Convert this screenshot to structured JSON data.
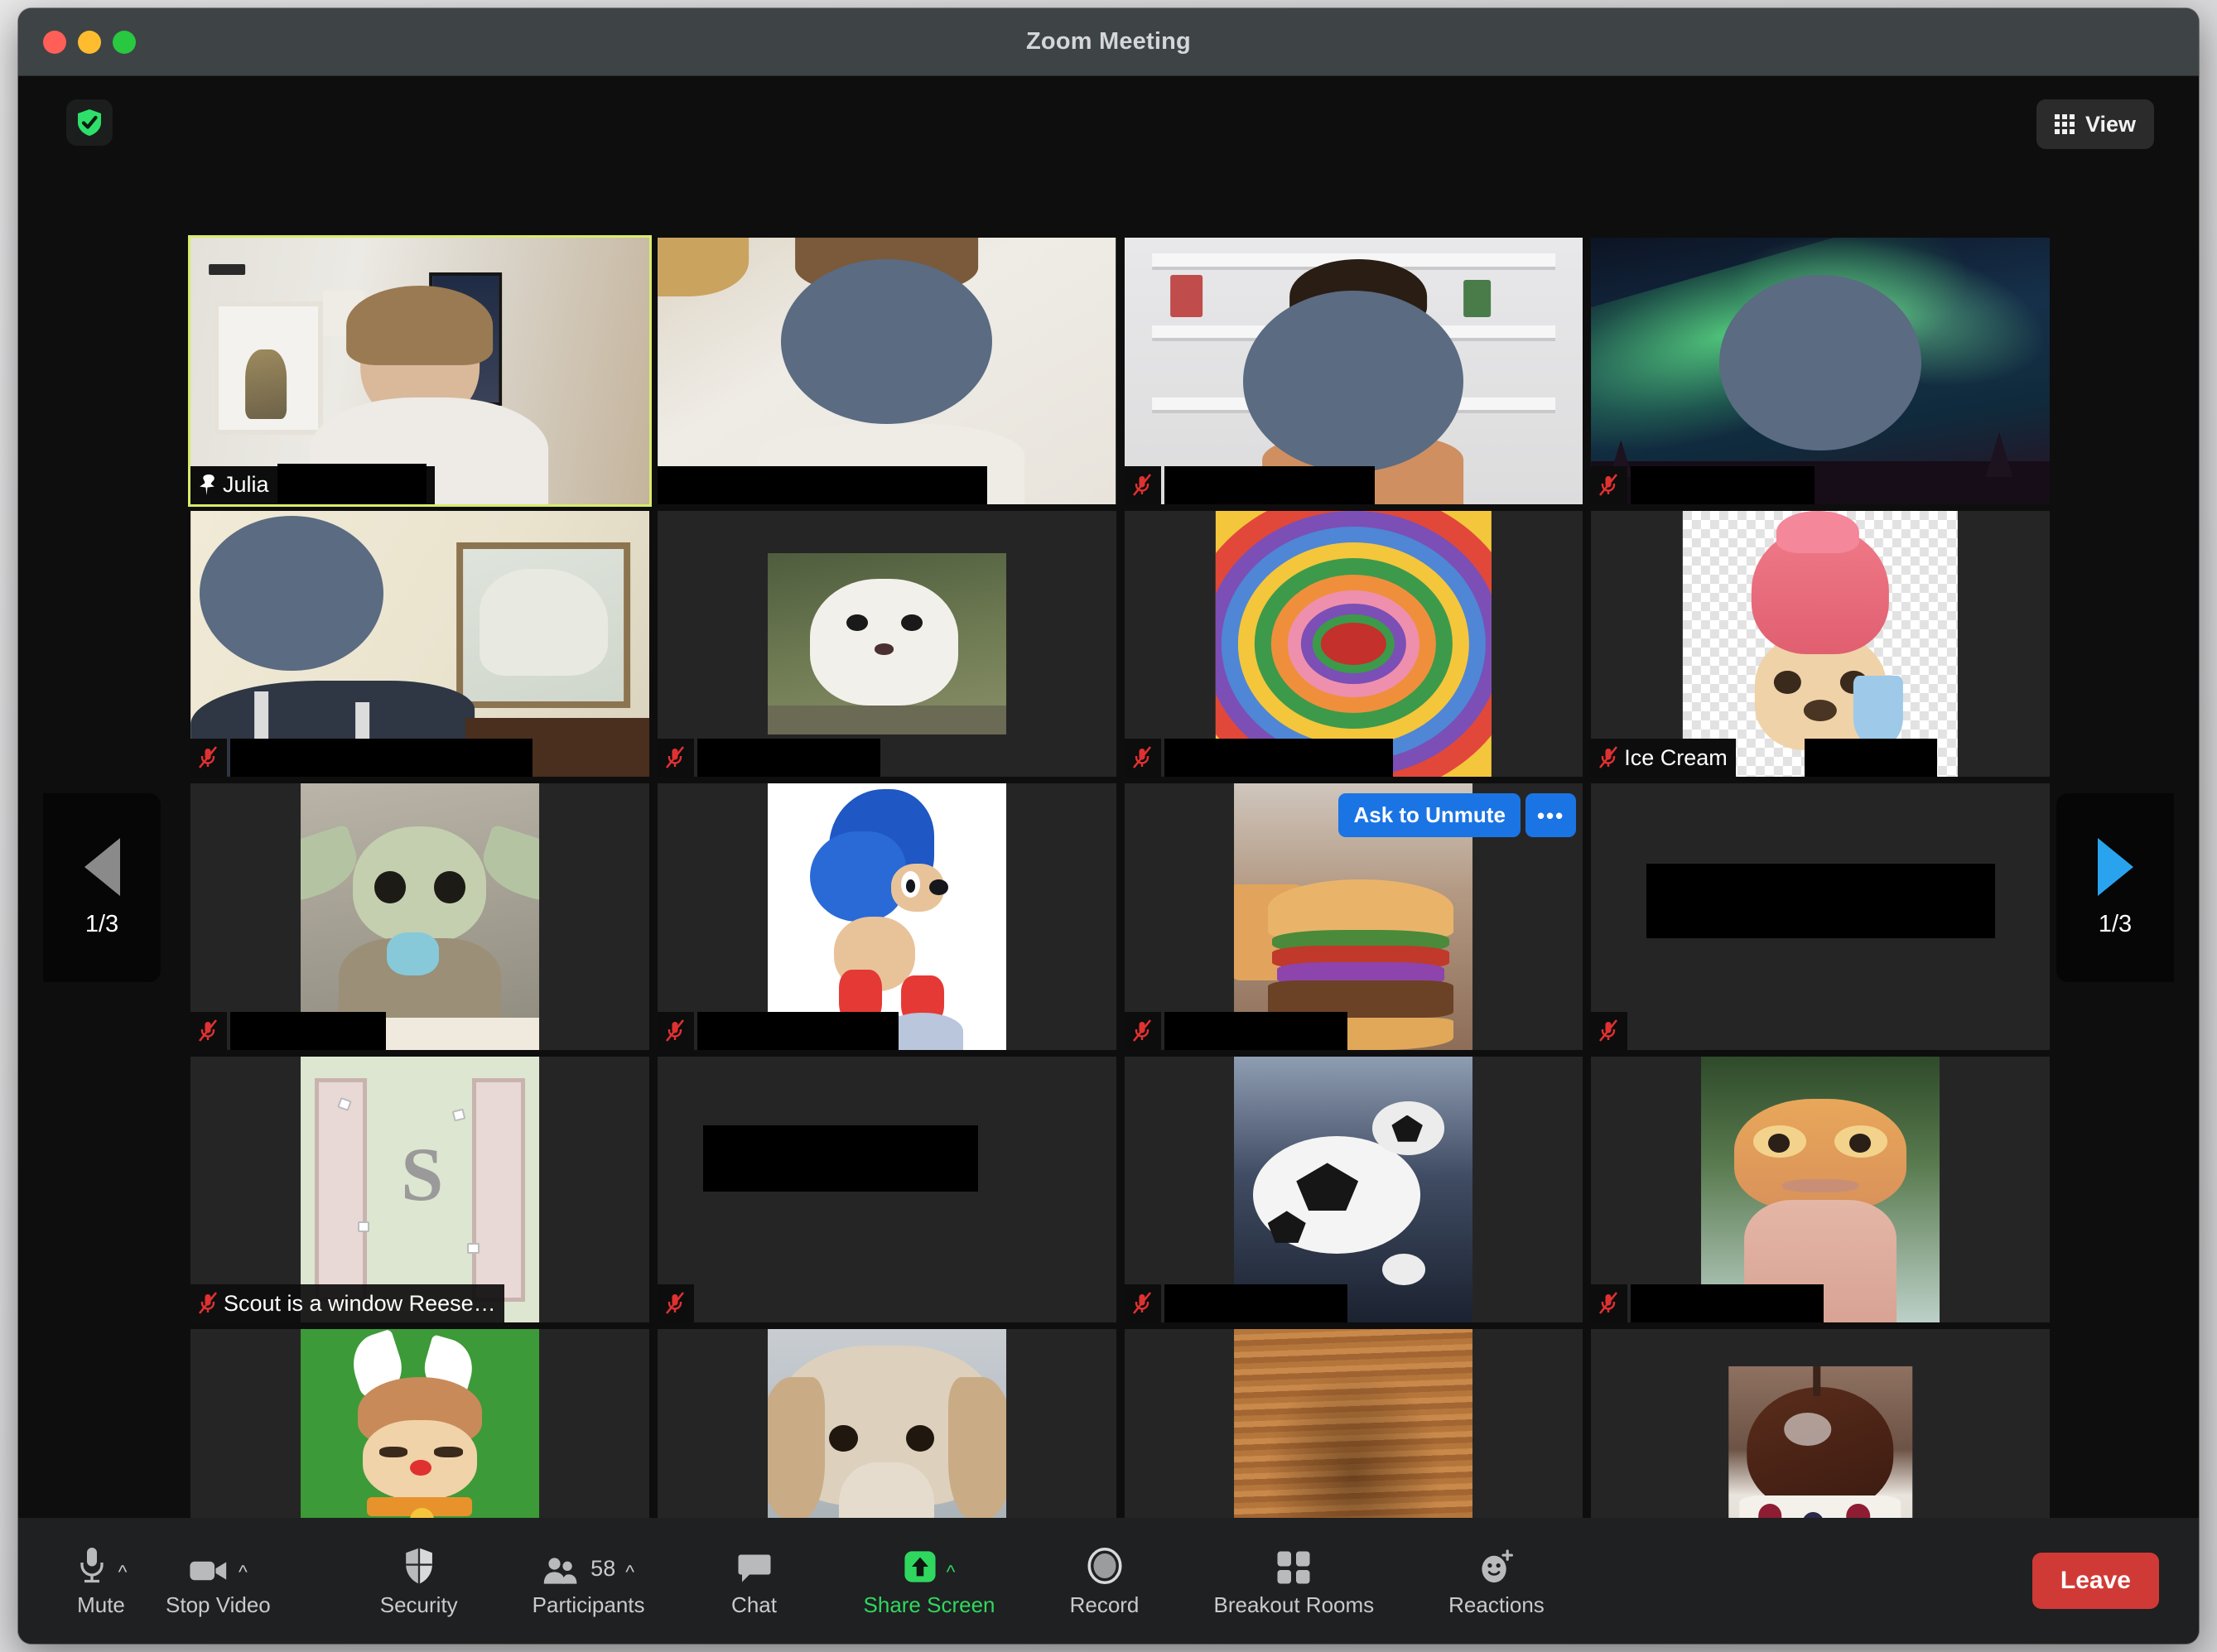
{
  "window": {
    "title": "Zoom Meeting",
    "traffic_lights": [
      "close",
      "minimize",
      "maximize"
    ]
  },
  "topbar": {
    "encryption_icon": "shield-check-icon",
    "view_button": {
      "label": "View",
      "icon": "grid-icon"
    }
  },
  "pager": {
    "left": {
      "icon": "chevron-left-icon",
      "label": "1/3",
      "enabled": false
    },
    "right": {
      "icon": "chevron-right-icon",
      "label": "1/3",
      "enabled": true
    }
  },
  "popup": {
    "ask_to_unmute": "Ask to Unmute",
    "more_options": "•••"
  },
  "grid": {
    "columns": 4,
    "rows": 5,
    "tiles": [
      {
        "id": 1,
        "name": "Julia",
        "redacted_name": true,
        "active_speaker": true,
        "pinned": true,
        "muted": false,
        "kind": "webcam-person",
        "media": "room-with-shelf"
      },
      {
        "id": 2,
        "name": "",
        "redacted_name": true,
        "active_speaker": false,
        "pinned": false,
        "muted": false,
        "kind": "webcam-person",
        "media": "light-wall"
      },
      {
        "id": 3,
        "name": "",
        "redacted_name": true,
        "active_speaker": false,
        "pinned": false,
        "muted": true,
        "kind": "webcam-person",
        "media": "white-shelves"
      },
      {
        "id": 4,
        "name": "",
        "redacted_name": true,
        "active_speaker": false,
        "pinned": false,
        "muted": true,
        "kind": "webcam-person",
        "media": "aurora-background"
      },
      {
        "id": 5,
        "name": "",
        "redacted_name": true,
        "active_speaker": false,
        "pinned": false,
        "muted": true,
        "kind": "webcam-person",
        "media": "bedroom-painting"
      },
      {
        "id": 6,
        "name": "",
        "redacted_name": true,
        "active_speaker": false,
        "pinned": false,
        "muted": true,
        "kind": "avatar-photo",
        "media": "white-ferret"
      },
      {
        "id": 7,
        "name": "",
        "redacted_name": true,
        "active_speaker": false,
        "pinned": false,
        "muted": true,
        "kind": "avatar-photo",
        "media": "rainbow-spiral"
      },
      {
        "id": 8,
        "name": "Ice Cream",
        "redacted_name": true,
        "active_speaker": false,
        "pinned": false,
        "muted": true,
        "kind": "avatar-photo",
        "media": "ice-cream-pug"
      },
      {
        "id": 9,
        "name": "",
        "redacted_name": true,
        "active_speaker": false,
        "pinned": false,
        "muted": true,
        "kind": "avatar-photo",
        "media": "baby-yoda"
      },
      {
        "id": 10,
        "name": "",
        "redacted_name": true,
        "active_speaker": false,
        "pinned": false,
        "muted": true,
        "kind": "avatar-photo",
        "media": "sonic-hedgehog"
      },
      {
        "id": 11,
        "name": "",
        "redacted_name": true,
        "active_speaker": false,
        "pinned": false,
        "muted": true,
        "kind": "avatar-photo",
        "media": "burger",
        "has_unmute_popup": true
      },
      {
        "id": 12,
        "name": "",
        "redacted_name": true,
        "active_speaker": false,
        "pinned": false,
        "muted": true,
        "kind": "no-video",
        "media": ""
      },
      {
        "id": 13,
        "name": "Scout is a window Reese…",
        "redacted_name": false,
        "active_speaker": false,
        "pinned": false,
        "muted": true,
        "kind": "avatar-photo",
        "media": "scout-window-sign"
      },
      {
        "id": 14,
        "name": "",
        "redacted_name": true,
        "active_speaker": false,
        "pinned": false,
        "muted": true,
        "kind": "no-video",
        "media": ""
      },
      {
        "id": 15,
        "name": "",
        "redacted_name": true,
        "active_speaker": false,
        "pinned": false,
        "muted": true,
        "kind": "avatar-photo",
        "media": "soccer-balls"
      },
      {
        "id": 16,
        "name": "",
        "redacted_name": true,
        "active_speaker": false,
        "pinned": false,
        "muted": true,
        "kind": "avatar-photo",
        "media": "leopard-gecko"
      },
      {
        "id": 17,
        "name": "",
        "redacted_name": true,
        "active_speaker": false,
        "pinned": false,
        "muted": true,
        "kind": "avatar-photo",
        "media": "reindeer-cartoon"
      },
      {
        "id": 18,
        "name": "",
        "redacted_name": true,
        "active_speaker": false,
        "pinned": false,
        "muted": true,
        "kind": "avatar-photo",
        "media": "golden-dog"
      },
      {
        "id": 19,
        "name": "",
        "redacted_name": true,
        "active_speaker": false,
        "pinned": false,
        "muted": true,
        "kind": "avatar-photo",
        "media": "furry-dog"
      },
      {
        "id": 20,
        "name": "",
        "redacted_name": true,
        "active_speaker": false,
        "pinned": false,
        "muted": true,
        "kind": "avatar-photo",
        "media": "chocolate-dessert"
      }
    ]
  },
  "toolbar": {
    "items": [
      {
        "key": "mute",
        "label": "Mute",
        "icon": "microphone-icon",
        "caret": true,
        "highlight": false
      },
      {
        "key": "stop_video",
        "label": "Stop Video",
        "icon": "video-camera-icon",
        "caret": true,
        "highlight": false
      },
      {
        "key": "security",
        "label": "Security",
        "icon": "shield-icon",
        "caret": false,
        "highlight": false
      },
      {
        "key": "participants",
        "label": "Participants",
        "icon": "people-icon",
        "caret": true,
        "highlight": false,
        "count": "58"
      },
      {
        "key": "chat",
        "label": "Chat",
        "icon": "chat-bubble-icon",
        "caret": false,
        "highlight": false
      },
      {
        "key": "share_screen",
        "label": "Share Screen",
        "icon": "share-arrow-icon",
        "caret": true,
        "highlight": true
      },
      {
        "key": "record",
        "label": "Record",
        "icon": "record-circle-icon",
        "caret": false,
        "highlight": false
      },
      {
        "key": "breakout_rooms",
        "label": "Breakout Rooms",
        "icon": "squares-grid-icon",
        "caret": false,
        "highlight": false
      },
      {
        "key": "reactions",
        "label": "Reactions",
        "icon": "smiley-plus-icon",
        "caret": false,
        "highlight": false
      }
    ],
    "leave_label": "Leave"
  },
  "colors": {
    "accent_green": "#2fd75f",
    "active_speaker_border": "#d9ec6a",
    "leave_red": "#d03a36",
    "unmute_blue": "#1b74e4",
    "muted_red": "#e03131",
    "pager_active": "#2aa3ef",
    "pager_disabled": "#8a8a8a"
  }
}
